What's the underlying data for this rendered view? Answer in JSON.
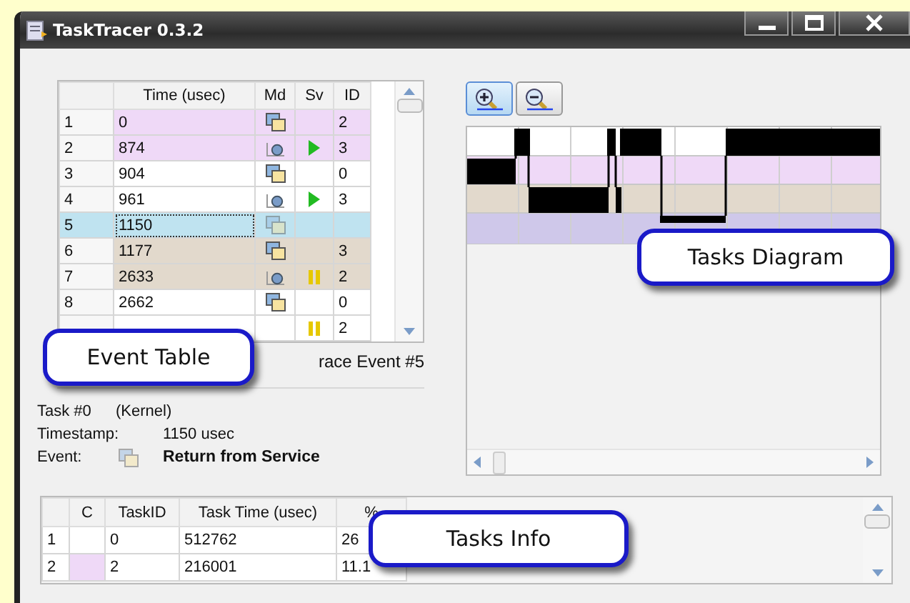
{
  "window": {
    "title": "TaskTracer 0.3.2"
  },
  "event_table": {
    "columns": [
      "Time (usec)",
      "Md",
      "Sv",
      "ID"
    ],
    "rows": [
      {
        "number": "1",
        "time": "0",
        "md": {
          "kind": "window"
        },
        "id": "2",
        "color": "#efd9f7",
        "selected": false
      },
      {
        "number": "2",
        "time": "874",
        "md": {
          "kind": "ball"
        },
        "sv": {
          "kind": "play"
        },
        "id": "3",
        "color": "#efd9f7",
        "selected": false
      },
      {
        "number": "3",
        "time": "904",
        "md": {
          "kind": "window"
        },
        "id": "0",
        "color": "#ffffff",
        "selected": false
      },
      {
        "number": "4",
        "time": "961",
        "md": {
          "kind": "ball"
        },
        "sv": {
          "kind": "play"
        },
        "id": "3",
        "color": "#ffffff",
        "selected": false
      },
      {
        "number": "5",
        "time": "1150",
        "md": {
          "kind": "window"
        },
        "selected": true
      },
      {
        "number": "6",
        "time": "1177",
        "md": {
          "kind": "window"
        },
        "id": "3",
        "color": "#e2d9cc",
        "selected": false
      },
      {
        "number": "7",
        "time": "2633",
        "md": {
          "kind": "ball"
        },
        "sv": {
          "kind": "pause"
        },
        "id": "2",
        "color": "#e2d9cc",
        "selected": false
      },
      {
        "number": "8",
        "time": "2662",
        "md": {
          "kind": "window"
        },
        "id": "0",
        "color": "#ffffff",
        "selected": false
      },
      {
        "sv": {
          "kind": "pause"
        },
        "id": "2",
        "color": "#ffffff",
        "selected": false
      }
    ]
  },
  "trace_label": "race Event #5",
  "event_details": {
    "task": "Task #0",
    "task_name": "(Kernel)",
    "timestamp_label": "Timestamp:",
    "timestamp": "1150 usec",
    "event_label": "Event:",
    "event_icon": {
      "kind": "window"
    },
    "event": "Return from Service"
  },
  "zoom_buttons": [
    {
      "kind": "zoom-in",
      "selected": true
    },
    {
      "kind": "zoom-out",
      "selected": false
    }
  ],
  "tasks_info": {
    "columns": [
      "C",
      "TaskID",
      "Task Time (usec)",
      "%"
    ],
    "rows": [
      {
        "number": "1",
        "color": "#ffffff",
        "task_id": "0",
        "time": "512762",
        "percent": "26"
      },
      {
        "number": "2",
        "color": "#efd9f7",
        "task_id": "2",
        "time": "216001",
        "percent": "11.1"
      }
    ]
  },
  "callouts": [
    {
      "kind": "event-table",
      "text": "Event Table"
    },
    {
      "kind": "diagram",
      "text": "Tasks Diagram"
    },
    {
      "kind": "tasks-info",
      "text": "Tasks Info"
    }
  ]
}
